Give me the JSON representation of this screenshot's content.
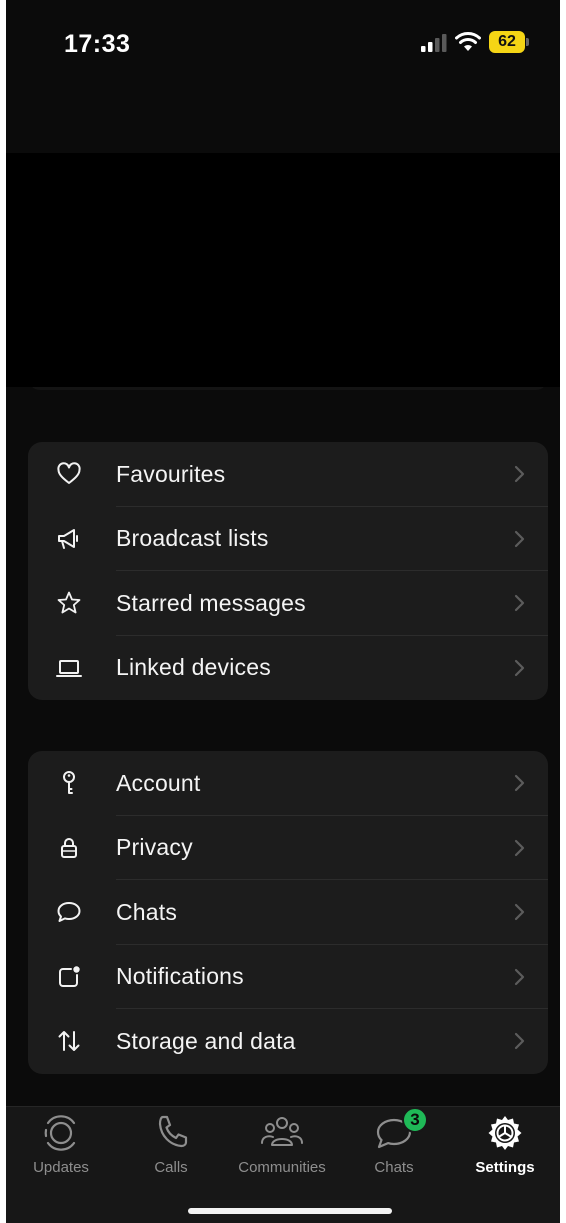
{
  "status_bar": {
    "time": "17:33",
    "battery_level": "62",
    "signal_icon": "cellular-signal-icon",
    "wifi_icon": "wifi-icon"
  },
  "groups": [
    {
      "items": [
        {
          "label": "Favourites",
          "icon": "heart-icon"
        },
        {
          "label": "Broadcast lists",
          "icon": "megaphone-icon"
        },
        {
          "label": "Starred messages",
          "icon": "star-icon"
        },
        {
          "label": "Linked devices",
          "icon": "laptop-icon"
        }
      ]
    },
    {
      "items": [
        {
          "label": "Account",
          "icon": "key-icon"
        },
        {
          "label": "Privacy",
          "icon": "lock-icon"
        },
        {
          "label": "Chats",
          "icon": "chat-bubble-icon"
        },
        {
          "label": "Notifications",
          "icon": "notification-icon"
        },
        {
          "label": "Storage and data",
          "icon": "arrows-up-down-icon"
        }
      ]
    }
  ],
  "tabs": [
    {
      "label": "Updates",
      "icon": "updates-icon"
    },
    {
      "label": "Calls",
      "icon": "phone-icon"
    },
    {
      "label": "Communities",
      "icon": "communities-icon"
    },
    {
      "label": "Chats",
      "icon": "chats-icon",
      "badge": "3"
    },
    {
      "label": "Settings",
      "icon": "settings-gear-icon",
      "active": true
    }
  ],
  "colors": {
    "background": "#0b0b0b",
    "group_background": "#1c1c1c",
    "badge_green": "#1fb957",
    "battery_yellow": "#f5d515"
  }
}
